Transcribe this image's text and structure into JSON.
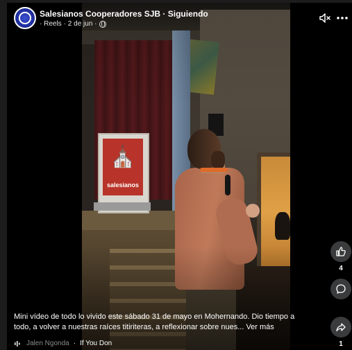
{
  "header": {
    "page_name": "Salesianos Cooperadores SJB",
    "separator": "·",
    "follow_status": "Siguiendo",
    "meta_prefix": "· Reels ·",
    "date": "2 de jun ·"
  },
  "icons": {
    "avatar": "salesianos-logo",
    "privacy": "globe-icon",
    "mute": "speaker-muted-icon",
    "more": "more-horizontal-icon",
    "like": "thumbs-up-icon",
    "comment": "comment-bubble-icon",
    "share": "share-arrow-icon",
    "audio": "sound-wave-icon"
  },
  "video": {
    "banner_text": "salesianos"
  },
  "actions": {
    "like_count": "4",
    "share_count": "1"
  },
  "caption": {
    "text": "Mini vídeo de todo lo vivido este sábado 31 de mayo en Mohernando. Dio tiempo a todo, a volver a nuestras raíces titiriteras, a reflexionar sobre nues...",
    "see_more": "Ver más"
  },
  "audio": {
    "artist": "Jalen Ngonda",
    "separator": "·",
    "track": "If You Don"
  },
  "colors": {
    "background": "#1c1c1c",
    "button_bg": "#3a3b3c",
    "banner_red": "#b8342a"
  }
}
